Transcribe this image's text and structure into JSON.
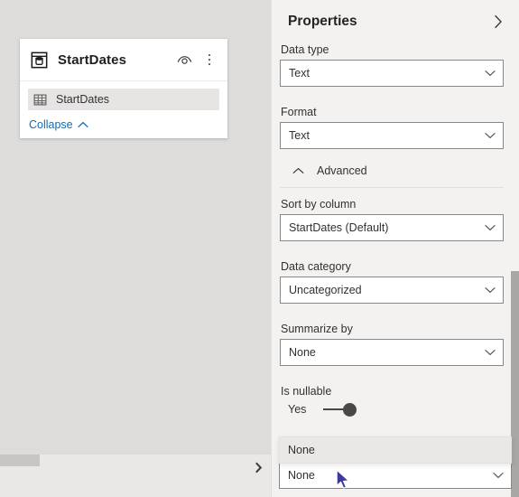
{
  "canvas": {
    "table_card": {
      "icon": "table-database-icon",
      "title": "StartDates",
      "eye_icon": "eye-hidden-icon",
      "menu_icon": "more-options-kebab-icon",
      "fields": [
        {
          "icon": "grid-table-icon",
          "label": "StartDates"
        }
      ],
      "collapse_label": "Collapse",
      "collapse_icon": "chevron-up-icon"
    },
    "horizontal_scrollbar": {
      "name": "horizontal-scrollbar"
    },
    "expand_icon": "chevron-right-icon"
  },
  "properties": {
    "title": "Properties",
    "collapse_icon": "chevron-right-icon",
    "data_type": {
      "label": "Data type",
      "value": "Text"
    },
    "format": {
      "label": "Format",
      "value": "Text"
    },
    "advanced": {
      "label": "Advanced",
      "chevron": "chevron-up-icon",
      "expanded": true,
      "sort_by_column": {
        "label": "Sort by column",
        "value": "StartDates (Default)"
      },
      "data_category": {
        "label": "Data category",
        "value": "Uncategorized"
      },
      "summarize_by": {
        "label": "Summarize by",
        "value": "None"
      },
      "is_nullable": {
        "label": "Is nullable",
        "state_label": "Yes",
        "on": true
      },
      "open_dropdown": {
        "selected": "None",
        "options": [
          "None"
        ]
      }
    }
  },
  "colors": {
    "canvas_bg": "#dedcdb",
    "panel_bg": "#f3f2f1",
    "card_bg": "#ffffff",
    "link_blue": "#0f6cbd",
    "text": "#323130",
    "border": "#8a8886",
    "scrollbar_thumb": "#a9a7a5",
    "highlight": "#e6e5e4"
  }
}
